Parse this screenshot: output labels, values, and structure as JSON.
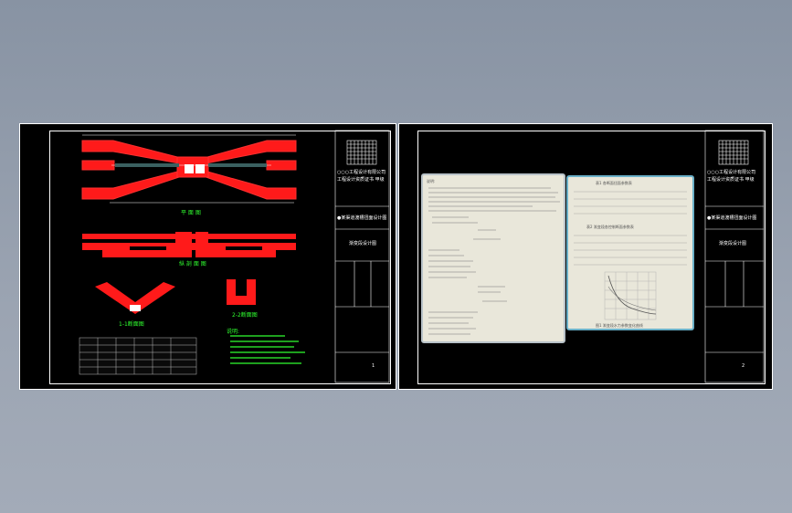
{
  "left_sheet": {
    "titleblock": {
      "company_line1": "○○○工程设计有限公司",
      "company_line2": "工程设计资质证书 甲级",
      "drawing_title": "●某渠道渡槽扭面设计图",
      "sheet_name": "渐变段设计图",
      "sheet_no": "1"
    },
    "labels": {
      "plan": "平 面 图",
      "elevation": "纵 剖 面 图",
      "section1": "1-1断面图",
      "section2": "2-2断面图",
      "notes_title": "说明:"
    }
  },
  "right_sheet": {
    "titleblock": {
      "company_line1": "○○○工程设计有限公司",
      "company_line2": "工程设计资质证书 甲级",
      "drawing_title": "●某渠道渡槽扭面设计图",
      "sheet_name": "渐变段设计图",
      "sheet_no": "2"
    },
    "panel_left_heading": "说明:",
    "panel_right_table1": "表1 各断面扭面参数表",
    "panel_right_table2": "表2 渐变段各控制断面参数表",
    "panel_right_chart": "图1 渐变段水力参数变化曲线"
  },
  "colors": {
    "drawing_red": "#ff1a1a",
    "annotation_green": "#30ff30",
    "sheet_background": "#000000",
    "panel_background": "#e9e7da"
  }
}
